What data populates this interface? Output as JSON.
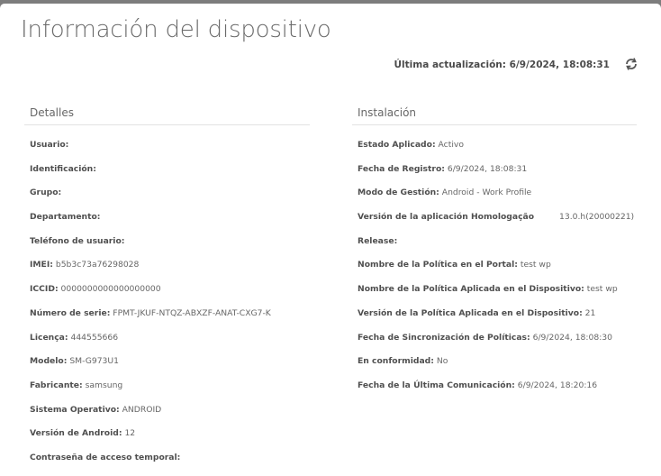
{
  "header": {
    "title": "Información del dispositivo",
    "last_update_label": "Última actualización:",
    "last_update_value": "6/9/2024, 18:08:31",
    "refresh_icon": "refresh-icon"
  },
  "details": {
    "heading": "Detalles",
    "rows": [
      {
        "label": "Usuario:",
        "value": ""
      },
      {
        "label": "Identificación:",
        "value": ""
      },
      {
        "label": "Grupo:",
        "value": ""
      },
      {
        "label": "Departamento:",
        "value": ""
      },
      {
        "label": "Teléfono de usuario:",
        "value": ""
      },
      {
        "label": "IMEI:",
        "value": "b5b3c73a76298028"
      },
      {
        "label": "ICCID:",
        "value": "0000000000000000000"
      },
      {
        "label": "Número de serie:",
        "value": "FPMT-JKUF-NTQZ-ABXZF-ANAT-CXG7-K"
      },
      {
        "label": "Licença:",
        "value": "444555666"
      },
      {
        "label": "Modelo:",
        "value": "SM-G973U1"
      },
      {
        "label": "Fabricante:",
        "value": "samsung"
      },
      {
        "label": "Sistema Operativo:",
        "value": "ANDROID"
      },
      {
        "label": "Versión de Android:",
        "value": "12"
      },
      {
        "label": "Contraseña de acceso temporal:",
        "value": ""
      }
    ]
  },
  "installation": {
    "heading": "Instalación",
    "rows": [
      {
        "label": "Estado Aplicado:",
        "value": "Activo"
      },
      {
        "label": "Fecha de Registro:",
        "value": "6/9/2024, 18:08:31"
      },
      {
        "label": "Modo de Gestión:",
        "value": "Android - Work Profile"
      },
      {
        "label": "Versión de la aplicación Homologação",
        "value": "13.0.h(20000221)"
      },
      {
        "label": "Release:",
        "value": ""
      },
      {
        "label": "Nombre de la Política en el Portal:",
        "value": "test wp"
      },
      {
        "label": "Nombre de la Política Aplicada en el Dispositivo:",
        "value": "test wp"
      },
      {
        "label": "Versión de la Política Aplicada en el Dispositivo:",
        "value": "21"
      },
      {
        "label": "Fecha de Sincronización de Políticas:",
        "value": "6/9/2024, 18:08:30"
      },
      {
        "label": "En conformidad:",
        "value": "No"
      },
      {
        "label": "Fecha de la Última Comunicación:",
        "value": "6/9/2024, 18:20:16"
      }
    ]
  }
}
